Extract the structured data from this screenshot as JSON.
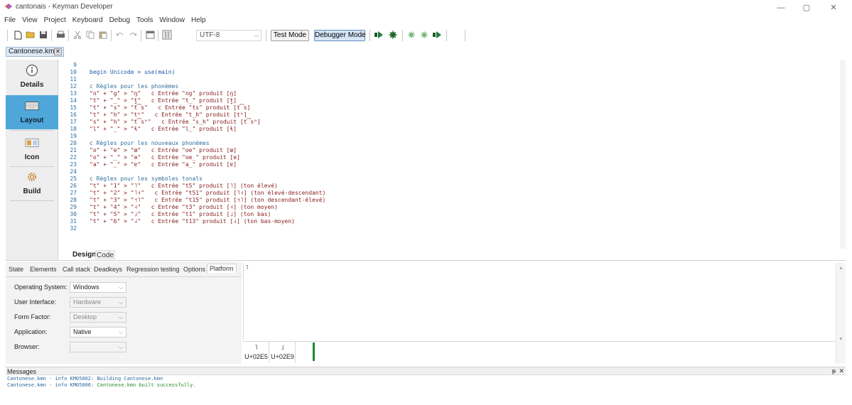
{
  "window": {
    "title": "cantonais - Keyman Developer",
    "min_glyph": "—",
    "max_glyph": "▢",
    "close_glyph": "✕"
  },
  "menu": [
    "File",
    "View",
    "Project",
    "Keyboard",
    "Debug",
    "Tools",
    "Window",
    "Help"
  ],
  "toolbar": {
    "encoding": "UTF-8",
    "test_mode": "Test Mode",
    "debugger_mode": "Debugger Mode"
  },
  "file_tab": {
    "label": "Cantonese.kmn",
    "close_glyph": "✕"
  },
  "sidebar": {
    "items": [
      {
        "label": "Details",
        "icon": "info-icon"
      },
      {
        "label": "Layout",
        "icon": "keyboard-icon"
      },
      {
        "label": "Icon",
        "icon": "image-icon"
      },
      {
        "label": "Build",
        "icon": "gear-icon"
      }
    ]
  },
  "code": {
    "lines": [
      {
        "n": "9",
        "text": ""
      },
      {
        "n": "10",
        "text": "begin Unicode > use(main)",
        "style": "kw"
      },
      {
        "n": "11",
        "text": ""
      },
      {
        "n": "12",
        "text": "c Règles pour les phonèmes",
        "style": "cm"
      },
      {
        "n": "13",
        "text": "\"n\" + \"g\" > \"ŋ\"   c Entrée \"ng\" produit [ŋ]"
      },
      {
        "n": "14",
        "text": "\"t\" + \"_\" > \"t̪\"   c Entrée \"t_\" produit [t̪]"
      },
      {
        "n": "15",
        "text": "\"t\" + \"s\" > \"t͡s\"   c Entrée \"ts\" produit [t͡s]"
      },
      {
        "n": "16",
        "text": "\"t\" + \"h\" > \"tʰ\"   c Entrée \"t_h\" produit [tʰ]"
      },
      {
        "n": "17",
        "text": "\"s\" + \"h\" > \"t͡sʰ\"   c Entrée \"s_h\" produit [t͡sʰ]"
      },
      {
        "n": "18",
        "text": "\"l\" + \"_\" > \"ɬ\"   c Entrée \"l_\" produit [ɬ]"
      },
      {
        "n": "19",
        "text": ""
      },
      {
        "n": "20",
        "text": "c Règles pour les nouveaux phonèmes",
        "style": "cm"
      },
      {
        "n": "21",
        "text": "\"o\" + \"e\" > \"œ\"   c Entrée \"oe\" produit [œ]"
      },
      {
        "n": "22",
        "text": "\"o\" + \"_\" > \"ɵ\"   c Entrée \"oe_\" produit [ɵ]"
      },
      {
        "n": "23",
        "text": "\"a\" + \"_\" > \"ɐ\"   c Entrée \"a_\" produit [ɐ]"
      },
      {
        "n": "24",
        "text": ""
      },
      {
        "n": "25",
        "text": "c Règles pour les symboles tonals",
        "style": "cm"
      },
      {
        "n": "26",
        "text": "\"t\" + \"1\" > \"˥\"   c Entrée \"t5\" produit [˥] (ton élevé)"
      },
      {
        "n": "27",
        "text": "\"t\" + \"2\" > \"˥˧\"   c Entrée \"t51\" produit [˥˧] (ton élevé-descendant)"
      },
      {
        "n": "28",
        "text": "\"t\" + \"3\" > \"˦˥\"   c Entrée \"t15\" produit [˦˥] (ton descendant-élevé)"
      },
      {
        "n": "29",
        "text": "\"t\" + \"4\" > \"˧\"   c Entrée \"t3\" produit [˧] (ton moyen)"
      },
      {
        "n": "30",
        "text": "\"t\" + \"5\" > \"˩\"   c Entrée \"t1\" produit [˩] (ton bas)"
      },
      {
        "n": "31",
        "text": "\"t\" + \"6\" > \"˨\"   c Entrée \"t13\" produit [˨] (ton bas-moyen)"
      },
      {
        "n": "32",
        "text": ""
      }
    ]
  },
  "editor_tabs": {
    "design": "Design",
    "code": "Code"
  },
  "debug_tabs": [
    "State",
    "Elements",
    "Call stack",
    "Deadkeys",
    "Regression testing",
    "Options",
    "Platform"
  ],
  "platform": {
    "rows": [
      {
        "label": "Operating System:",
        "value": "Windows",
        "disabled": false
      },
      {
        "label": "User Interface:",
        "value": "Hardware",
        "disabled": true
      },
      {
        "label": "Form Factor:",
        "value": "Desktop",
        "disabled": true
      },
      {
        "label": "Application:",
        "value": "Native",
        "disabled": false
      },
      {
        "label": "Browser:",
        "value": "",
        "disabled": true
      }
    ]
  },
  "debug_output": {
    "text": "˥",
    "chars": [
      {
        "glyph": "˥",
        "code": "U+02E5"
      },
      {
        "glyph": "˩",
        "code": "U+02E9"
      }
    ]
  },
  "messages": {
    "title": "Messages",
    "pin_glyph": "ᵽ",
    "close_glyph": "✕",
    "lines": [
      {
        "prefix": "Cantonese.kmn - info KM05002: ",
        "text": "Building Cantonese.kmn",
        "ok": false
      },
      {
        "prefix": "Cantonese.kmn - info KM05006: ",
        "text": "Cantonese.kmn built successfully.",
        "ok": true
      }
    ]
  },
  "colors": {
    "accent": "#4fa6d9",
    "success": "#2a8a30",
    "cursor": "#1f8a2c"
  }
}
